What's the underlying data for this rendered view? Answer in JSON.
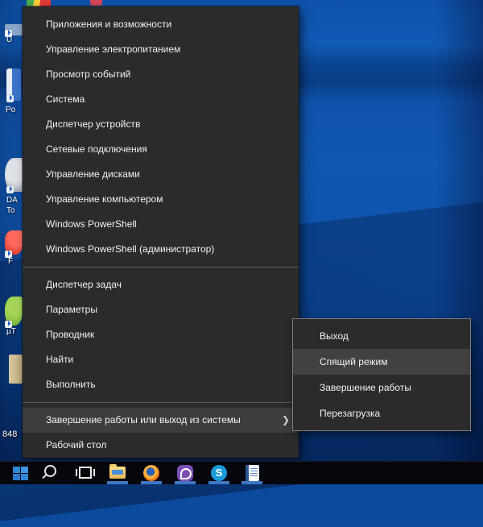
{
  "main_menu": {
    "items": [
      {
        "label": "Приложения и возможности"
      },
      {
        "label": "Управление электропитанием"
      },
      {
        "label": "Просмотр событий"
      },
      {
        "label": "Система"
      },
      {
        "label": "Диспетчер устройств"
      },
      {
        "label": "Сетевые подключения"
      },
      {
        "label": "Управление дисками"
      },
      {
        "label": "Управление компьютером"
      },
      {
        "label": "Windows PowerShell"
      },
      {
        "label": "Windows PowerShell (администратор)"
      },
      {
        "label": "Диспетчер задач"
      },
      {
        "label": "Параметры"
      },
      {
        "label": "Проводник"
      },
      {
        "label": "Найти"
      },
      {
        "label": "Выполнить"
      },
      {
        "label": "Завершение работы или выход из системы"
      },
      {
        "label": "Рабочий стол"
      }
    ],
    "submenu_arrow": "❯"
  },
  "submenu": {
    "items": [
      {
        "label": "Выход"
      },
      {
        "label": "Спящий режим",
        "highlighted": true
      },
      {
        "label": "Завершение работы"
      },
      {
        "label": "Перезагрузка"
      }
    ]
  },
  "taskbar": {
    "icons": [
      "start",
      "search",
      "task-view",
      "file-explorer",
      "firefox",
      "viber",
      "skype",
      "word-document"
    ],
    "skype_letter": "S"
  },
  "desktop": {
    "labels": {
      "u": "U",
      "po": "Po",
      "da_line1": "DA",
      "da_line2": "To",
      "f": "F",
      "ut": "µT",
      "num": "848"
    }
  },
  "colors": {
    "menu_bg": "#2b2b2b",
    "menu_highlight": "#3d3d3d",
    "submenu_highlight": "#414141",
    "menu_text": "#f2f2f2",
    "separator": "#5e5e5e",
    "taskbar_bg": "#06060d",
    "accent_blue": "#3188d8",
    "wallpaper_blue": "#1157b2"
  }
}
